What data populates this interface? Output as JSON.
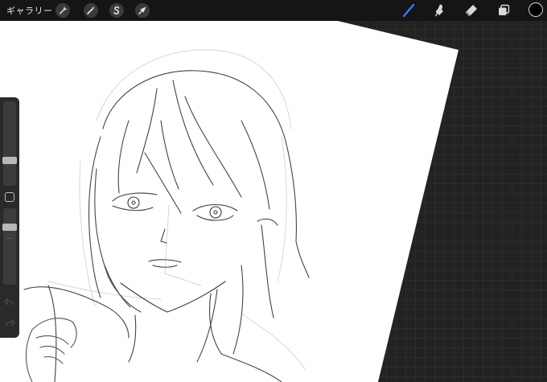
{
  "app": {
    "gallery_label": "ギャラリー"
  },
  "toolbar": {
    "left_tools": [
      {
        "icon": "wrench-icon",
        "name": "actions"
      },
      {
        "icon": "magic-wand-icon",
        "name": "adjustments"
      },
      {
        "icon": "selection-s-icon",
        "name": "selection"
      },
      {
        "icon": "arrow-cursor-icon",
        "name": "transform"
      }
    ],
    "right_tools": [
      {
        "icon": "brush-icon",
        "name": "paint",
        "active": true
      },
      {
        "icon": "smudge-icon",
        "name": "smudge"
      },
      {
        "icon": "eraser-icon",
        "name": "erase"
      },
      {
        "icon": "layers-icon",
        "name": "layers"
      }
    ],
    "active_color": "#000000"
  },
  "sidebar": {
    "brush_size_level": 0.72,
    "opacity_level": 0.22
  },
  "colors": {
    "accent": "#2f80ff",
    "workspace": "#222222",
    "canvas": "#ffffff"
  }
}
